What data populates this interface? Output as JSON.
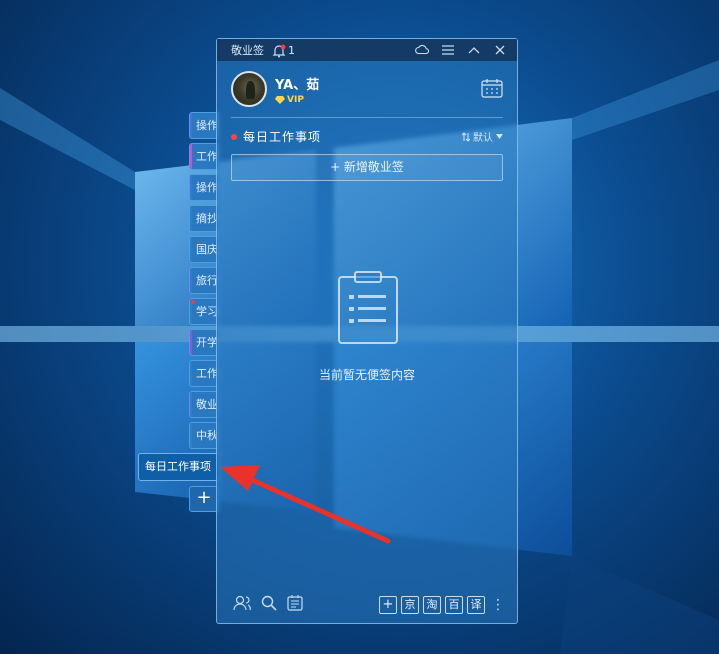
{
  "app": {
    "title": "敬业签",
    "notification_count": "1"
  },
  "user": {
    "name": "YA、茹",
    "badge": "VIP"
  },
  "list": {
    "title": "每日工作事项",
    "sort_label": "默认",
    "new_button": "+ 新增敬业签",
    "empty_text": "当前暂无便签内容"
  },
  "side_tabs": [
    {
      "label": "操作",
      "marker": "#4a6fd8"
    },
    {
      "label": "工作",
      "marker": "#d44bd4"
    },
    {
      "label": "操作",
      "marker": "#3f74d4"
    },
    {
      "label": "摘抄",
      "marker": "#2b80c8"
    },
    {
      "label": "国庆",
      "marker": "#2b80c8"
    },
    {
      "label": "旅行",
      "marker": "#3f74d4"
    },
    {
      "label": "学习",
      "marker": "#2b80c8",
      "dot": true
    },
    {
      "label": "开学",
      "marker": "#9b4fe0"
    },
    {
      "label": "工作",
      "marker": "#2b80c8"
    },
    {
      "label": "敬业",
      "marker": "#3f74d4"
    },
    {
      "label": "中秋",
      "marker": "#2b80c8"
    }
  ],
  "active_tab": "每日工作事项",
  "add_tab": "+",
  "bottom_tools": {
    "add": "+",
    "jd": "京",
    "taobao": "淘",
    "baidu": "百",
    "translate": "译"
  },
  "colors": {
    "accent_red": "#ff4242",
    "vip_gold": "#ffd44a",
    "arrow_red": "#e8322a"
  }
}
